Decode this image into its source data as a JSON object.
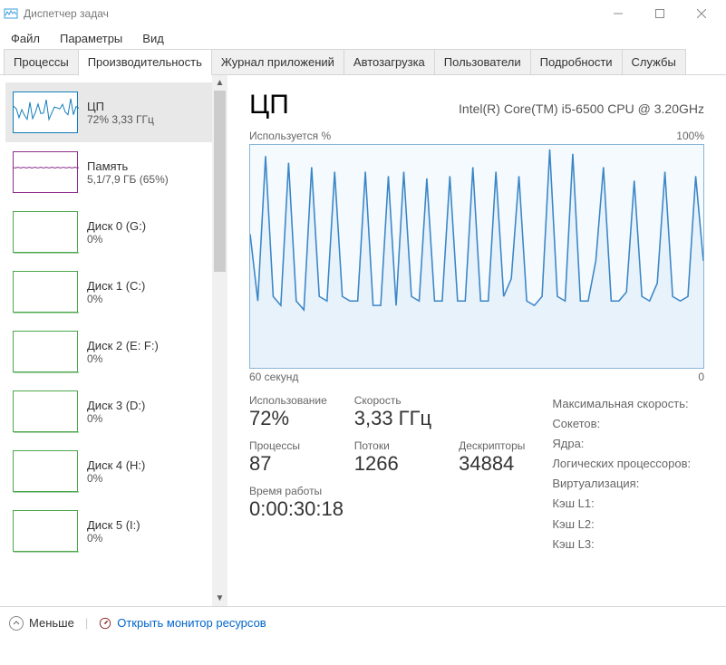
{
  "window": {
    "title": "Диспетчер задач"
  },
  "menu": {
    "file": "Файл",
    "options": "Параметры",
    "view": "Вид"
  },
  "tabs": {
    "processes": "Процессы",
    "performance": "Производительность",
    "app_history": "Журнал приложений",
    "startup": "Автозагрузка",
    "users": "Пользователи",
    "details": "Подробности",
    "services": "Службы"
  },
  "sidebar": [
    {
      "label": "ЦП",
      "sub": "72%  3,33 ГГц",
      "thumb": "cpu",
      "selected": true
    },
    {
      "label": "Память",
      "sub": "5,1/7,9 ГБ (65%)",
      "thumb": "mem"
    },
    {
      "label": "Диск 0 (G:)",
      "sub": "0%",
      "thumb": "disk"
    },
    {
      "label": "Диск 1 (C:)",
      "sub": "0%",
      "thumb": "disk"
    },
    {
      "label": "Диск 2 (E: F:)",
      "sub": "0%",
      "thumb": "disk"
    },
    {
      "label": "Диск 3 (D:)",
      "sub": "0%",
      "thumb": "disk"
    },
    {
      "label": "Диск 4 (H:)",
      "sub": "0%",
      "thumb": "disk"
    },
    {
      "label": "Диск 5 (I:)",
      "sub": "0%",
      "thumb": "disk"
    }
  ],
  "main": {
    "title": "ЦП",
    "subtitle": "Intel(R) Core(TM) i5-6500 CPU @ 3.20GHz",
    "chart_top_left": "Используется %",
    "chart_top_right": "100%",
    "chart_bottom_left": "60 секунд",
    "chart_bottom_right": "0"
  },
  "stats": {
    "usage_label": "Использование",
    "usage_value": "72%",
    "speed_label": "Скорость",
    "speed_value": "3,33 ГГц",
    "processes_label": "Процессы",
    "processes_value": "87",
    "threads_label": "Потоки",
    "threads_value": "1266",
    "handles_label": "Дескрипторы",
    "handles_value": "34884",
    "uptime_label": "Время работы",
    "uptime_value": "0:00:30:18"
  },
  "details": {
    "max_speed": "Максимальная скорость:",
    "sockets": "Сокетов:",
    "cores": "Ядра:",
    "logical": "Логических процессоров:",
    "virtualization": "Виртуализация:",
    "l1": "Кэш L1:",
    "l2": "Кэш L2:",
    "l3": "Кэш L3:"
  },
  "footer": {
    "less": "Меньше",
    "open_monitor": "Открыть монитор ресурсов"
  },
  "chart_data": {
    "type": "line",
    "title": "Используется %",
    "xlabel": "60 секунд",
    "ylabel": "%",
    "ylim": [
      0,
      100
    ],
    "xrange_seconds": [
      60,
      0
    ],
    "values": [
      60,
      30,
      95,
      32,
      28,
      92,
      30,
      26,
      90,
      32,
      30,
      88,
      32,
      30,
      30,
      88,
      28,
      28,
      86,
      28,
      88,
      32,
      30,
      85,
      30,
      30,
      86,
      30,
      30,
      90,
      30,
      30,
      88,
      32,
      40,
      86,
      30,
      28,
      32,
      98,
      32,
      30,
      96,
      30,
      30,
      48,
      90,
      30,
      30,
      34,
      84,
      32,
      30,
      38,
      88,
      32,
      30,
      32,
      86,
      48
    ]
  }
}
